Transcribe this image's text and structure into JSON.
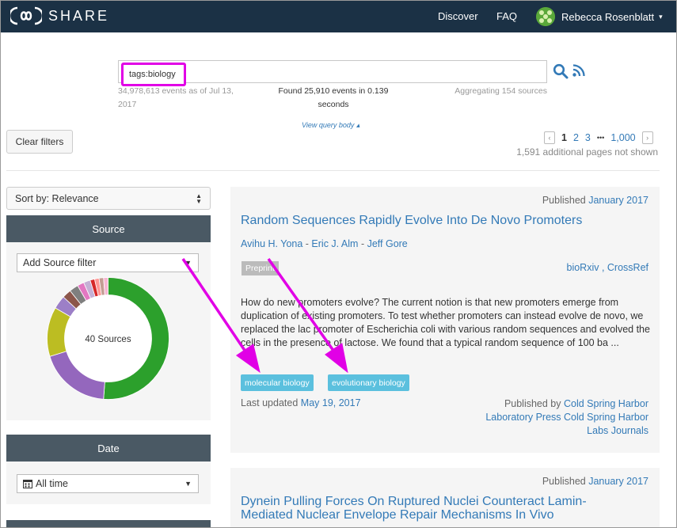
{
  "navbar": {
    "brand": "SHARE",
    "discover": "Discover",
    "faq": "FAQ",
    "user_name": "Rebecca Rosenblatt",
    "caret": "▾"
  },
  "search": {
    "value": "tags:biology",
    "stats_left": "34,978,613 events as of Jul 13, 2017",
    "stats_center": "Found 25,910 events in 0.139 seconds",
    "stats_right": "Aggregating 154 sources",
    "query_toggle": "View query body ▴"
  },
  "filters": {
    "clear_label": "Clear filters"
  },
  "pagination": {
    "prev": "‹",
    "pages": [
      "1",
      "2",
      "3"
    ],
    "ellipsis": "•••",
    "last": "1,000",
    "next": "›",
    "note": "1,591 additional pages not shown"
  },
  "sidebar": {
    "sort_label": "Sort by: Relevance",
    "source_title": "Source",
    "source_filter": "Add Source filter",
    "donut_center": "40 Sources",
    "date_title": "Date",
    "date_filter": "All time",
    "donut_segments": [
      {
        "value": 43,
        "color": "#2ca02c"
      },
      {
        "value": 16,
        "color": "#9467bd"
      },
      {
        "value": 11,
        "color": "#bcbd22"
      },
      {
        "value": 3,
        "color": "#9c7fc7"
      },
      {
        "value": 2,
        "color": "#8c564b"
      },
      {
        "value": 2,
        "color": "#7f7f7f"
      },
      {
        "value": 1.5,
        "color": "#e377c2"
      },
      {
        "value": 1.5,
        "color": "#c5b0d5"
      },
      {
        "value": 1,
        "color": "#d62728"
      },
      {
        "value": 1,
        "color": "#ff9896"
      },
      {
        "value": 1,
        "color": "#c49c94"
      },
      {
        "value": 1,
        "color": "#f7b6d2"
      }
    ]
  },
  "results": [
    {
      "published_prefix": "Published",
      "published_date": "January 2017",
      "title": "Random Sequences Rapidly Evolve Into De Novo Promoters",
      "authors": [
        "Avihu H. Yona",
        "Eric J. Alm",
        "Jeff Gore"
      ],
      "author_sep": " - ",
      "type": "Preprint",
      "providers": "bioRxiv , CrossRef",
      "abstract": "How do new promoters evolve? The current notion is that new promoters emerge from duplication of existing promoters. To test whether promoters can instead evolve de novo, we replaced the lac promoter of Escherichia coli with various random sequences and evolved the cells in the presence of lactose. We found that a typical random sequence of 100 ba ...",
      "tags": [
        "molecular biology",
        "evolutionary biology"
      ],
      "updated_prefix": "Last updated",
      "updated_date": "May 19, 2017",
      "publisher_prefix": "Published by",
      "publisher": "Cold Spring Harbor Laboratory Press Cold Spring Harbor Labs Journals"
    },
    {
      "published_prefix": "Published",
      "published_date": "January 2017",
      "title": "Dynein Pulling Forces On Ruptured Nuclei Counteract Lamin-Mediated Nuclear Envelope Repair Mechanisms In Vivo"
    }
  ],
  "colors": {
    "navbar": "#1b3145",
    "link": "#337ab7",
    "annotation": "#e100e6",
    "tag": "#5bc0de",
    "panel_head": "#4a5964"
  }
}
